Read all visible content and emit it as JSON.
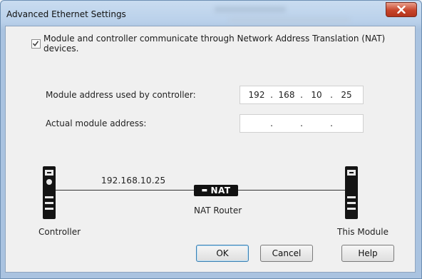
{
  "window": {
    "title": "Advanced Ethernet Settings"
  },
  "nat_option": {
    "checked": true,
    "label": "Module and controller communicate through Network Address Translation (NAT) devices."
  },
  "module_address": {
    "label": "Module address used by controller:",
    "octets": [
      "192",
      "168",
      "10",
      "25"
    ],
    "separator": "."
  },
  "actual_address": {
    "label": "Actual module address:",
    "octets": [
      "",
      "",
      "",
      ""
    ],
    "separator": "."
  },
  "diagram": {
    "link_address": "192.168.10.25",
    "nat_badge": "NAT",
    "router_label": "NAT Router",
    "controller_label": "Controller",
    "module_label": "This Module"
  },
  "buttons": {
    "ok": "OK",
    "cancel": "Cancel",
    "help": "Help"
  }
}
